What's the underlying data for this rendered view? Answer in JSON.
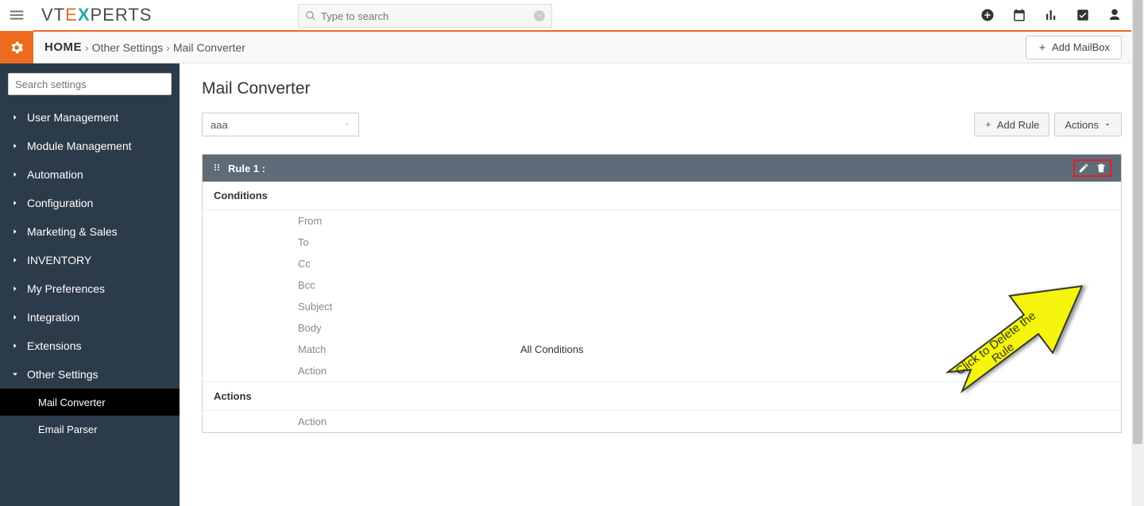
{
  "header": {
    "search_placeholder": "Type to search",
    "logo_text": "VTEXPERTS"
  },
  "breadcrumb": {
    "home": "HOME",
    "level1": "Other Settings",
    "level2": "Mail Converter"
  },
  "buttons": {
    "add_mailbox": "Add MailBox",
    "add_rule": "Add Rule",
    "actions": "Actions"
  },
  "sidebar": {
    "search_placeholder": "Search settings",
    "items": [
      {
        "label": "User Management"
      },
      {
        "label": "Module Management"
      },
      {
        "label": "Automation"
      },
      {
        "label": "Configuration"
      },
      {
        "label": "Marketing & Sales"
      },
      {
        "label": "INVENTORY"
      },
      {
        "label": "My Preferences"
      },
      {
        "label": "Integration"
      },
      {
        "label": "Extensions"
      },
      {
        "label": "Other Settings"
      }
    ],
    "subitems": [
      {
        "label": "Mail Converter",
        "active": true
      },
      {
        "label": "Email Parser",
        "active": false
      }
    ]
  },
  "main": {
    "title": "Mail Converter",
    "mailbox_selected": "aaa",
    "rule": {
      "title": "Rule 1 :",
      "conditions_heading": "Conditions",
      "actions_heading": "Actions",
      "rows": [
        {
          "label": "From",
          "value": ""
        },
        {
          "label": "To",
          "value": ""
        },
        {
          "label": "Cc",
          "value": ""
        },
        {
          "label": "Bcc",
          "value": ""
        },
        {
          "label": "Subject",
          "value": ""
        },
        {
          "label": "Body",
          "value": ""
        },
        {
          "label": "Match",
          "value": "All Conditions"
        },
        {
          "label": "Action",
          "value": ""
        }
      ],
      "action_rows": [
        {
          "label": "Action",
          "value": ""
        }
      ]
    }
  },
  "annotation": {
    "text": "Click to Delete the Rule"
  }
}
